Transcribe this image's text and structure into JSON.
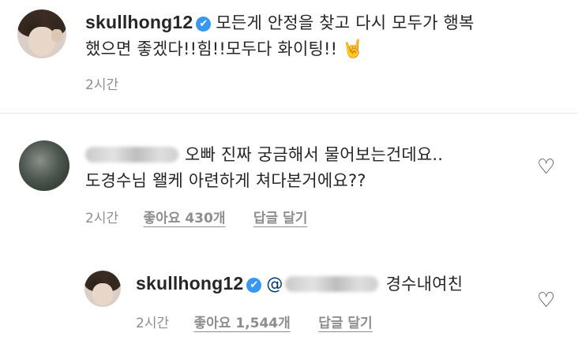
{
  "post": {
    "username": "skullhong12",
    "verified_glyph": "✔",
    "caption_line1": "모든게 안정을 찾고 다시 모두가 행복",
    "caption_line2": "했으면 좋겠다!!힘!!모두다 화이팅!!",
    "emoji_icon": "sign-of-the-horns-icon",
    "emoji_glyph": "🤘",
    "time": "2시간"
  },
  "comment": {
    "username_hidden": true,
    "text_line1": "오빠 진짜 궁금해서 물어보는건데요..",
    "text_line2": "도경수님 왤케 아련하게 쳐다본거에요??",
    "time": "2시간",
    "likes": "좋아요 430개",
    "reply_label": "답글 달기",
    "like_glyph": "♡"
  },
  "reply": {
    "username": "skullhong12",
    "verified_glyph": "✔",
    "mention_prefix": "@",
    "text": "경수내여친",
    "time": "2시간",
    "likes": "좋아요 1,544개",
    "reply_label": "답글 달기",
    "like_glyph": "♡"
  }
}
